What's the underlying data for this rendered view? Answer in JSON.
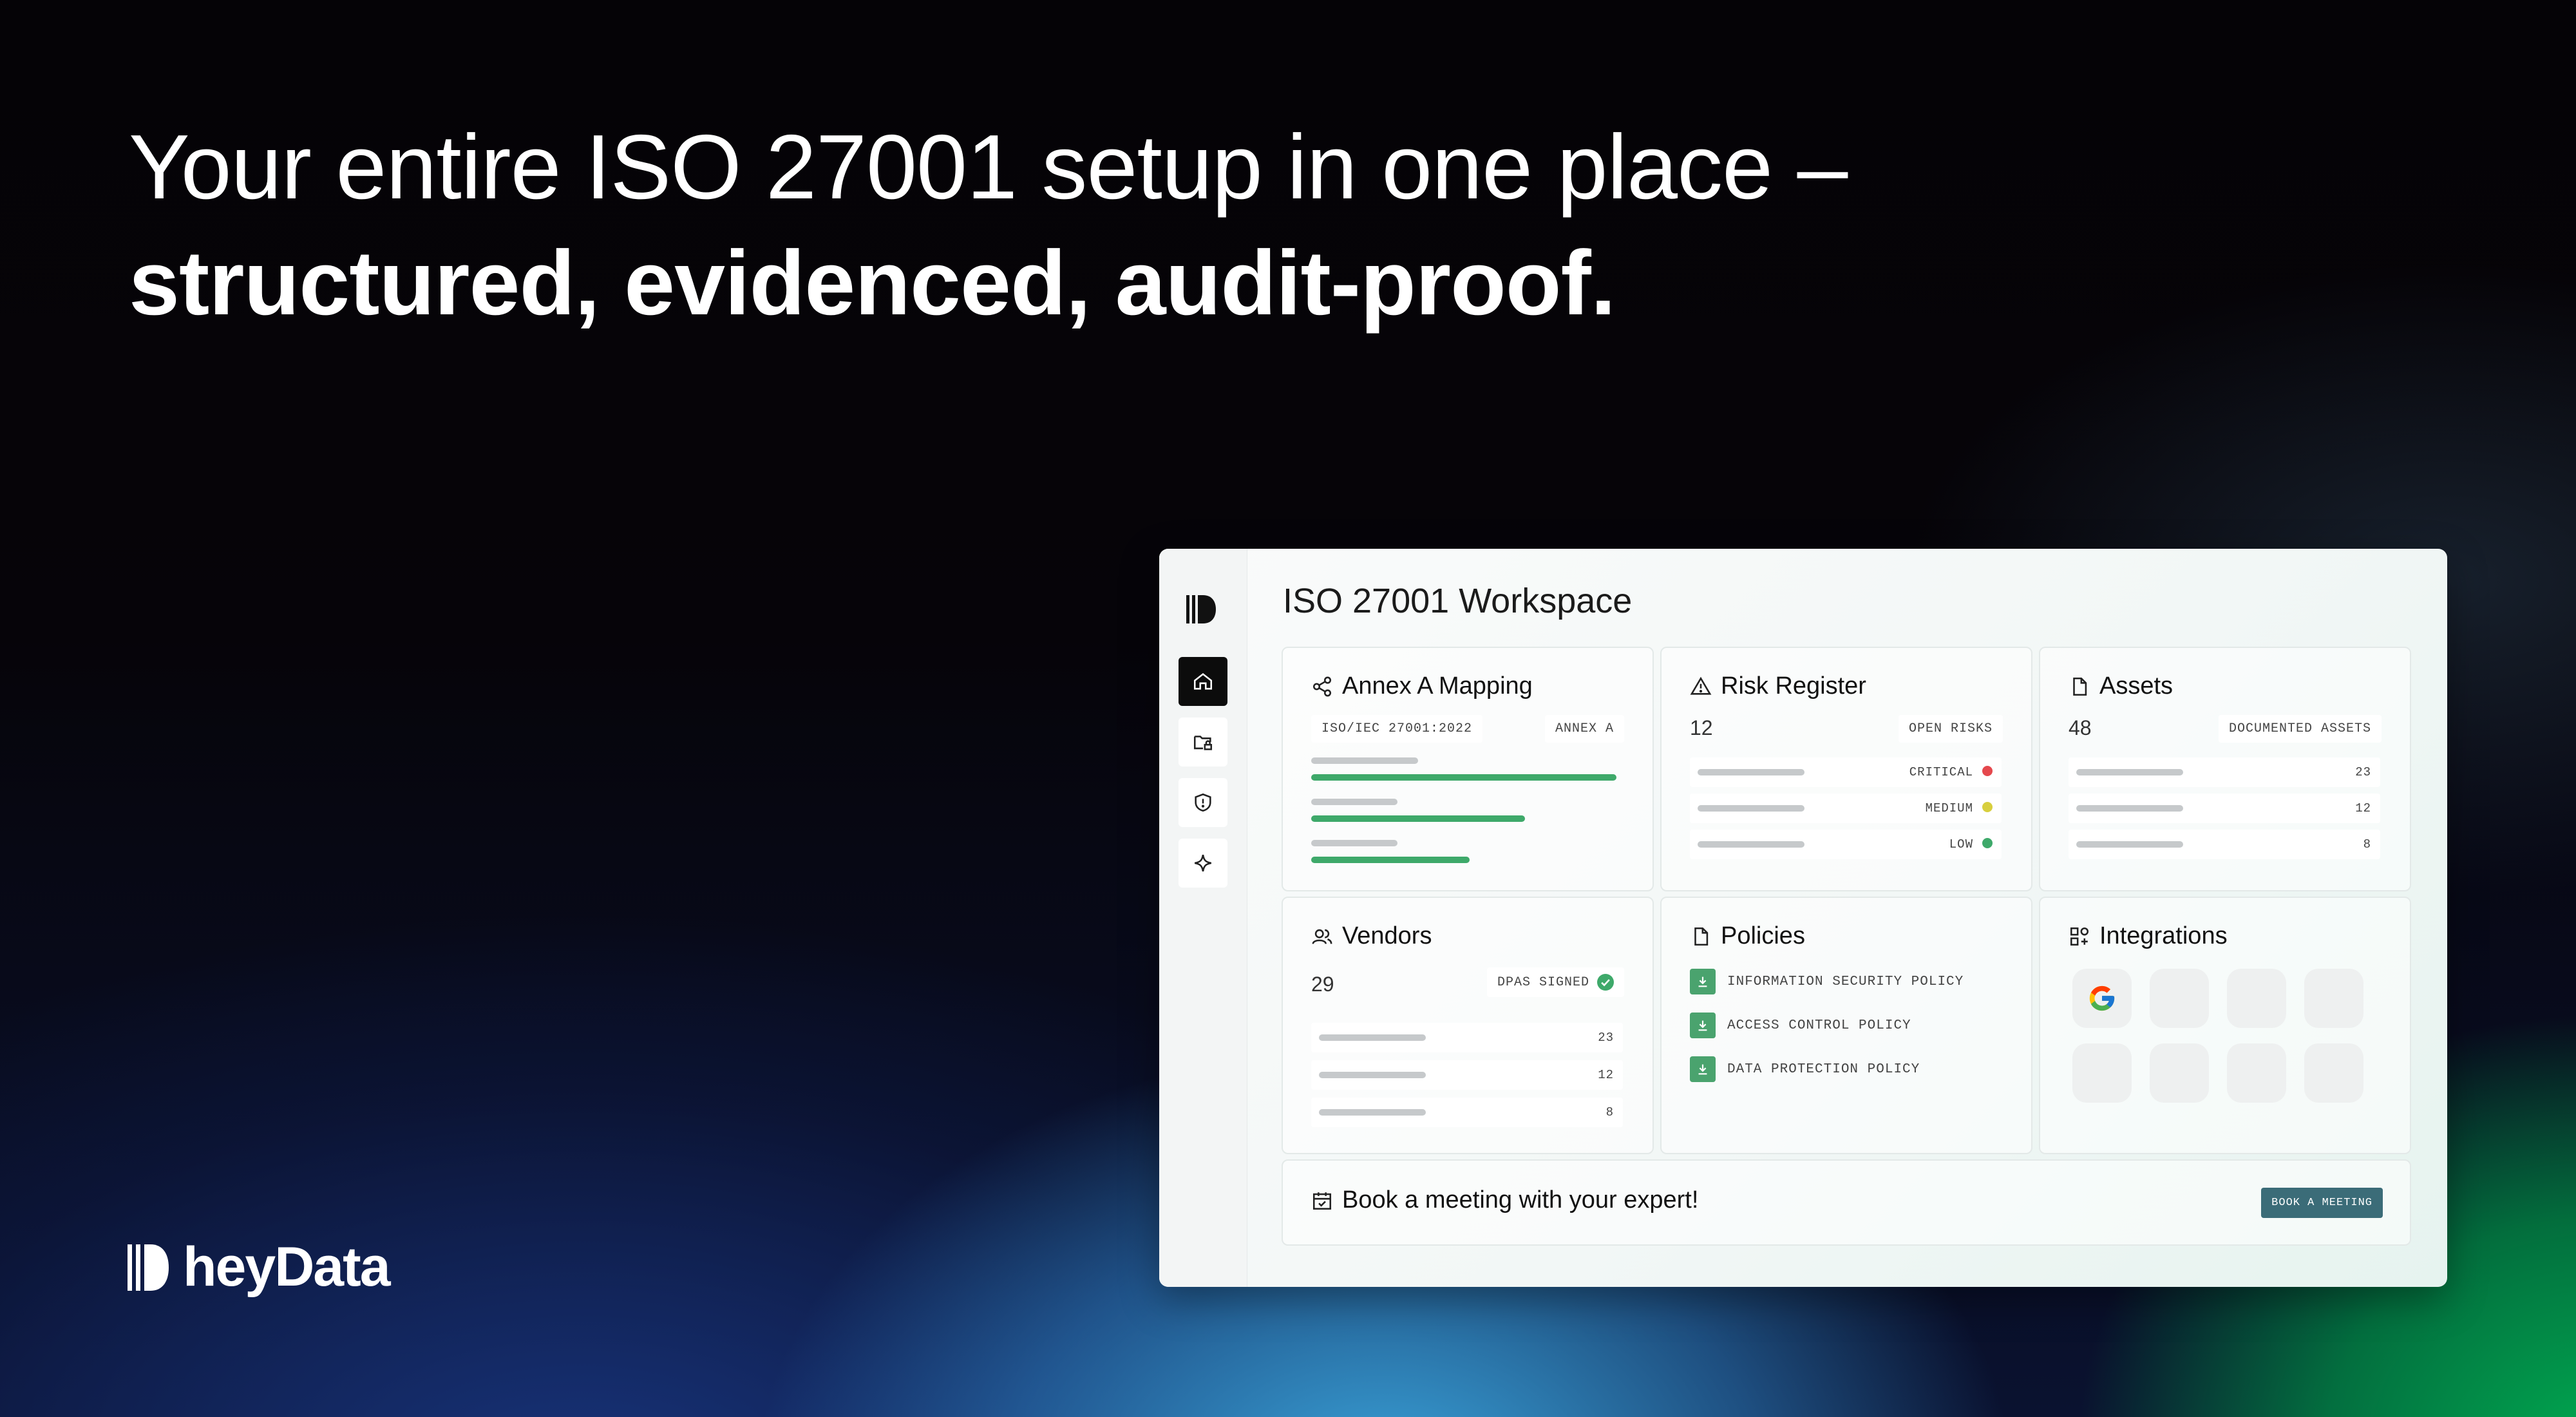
{
  "hero": {
    "line1": "Your entire ISO 27001 setup in one place –",
    "line2": "structured, evidenced, audit-proof."
  },
  "brand": {
    "name": "heyData"
  },
  "sidebar": {
    "items": [
      "home-icon",
      "folder-lock-icon",
      "shield-alert-icon",
      "sparkle-icon"
    ],
    "active": 0
  },
  "workspace": {
    "title": "ISO 27001 Workspace",
    "annex": {
      "title": "Annex A Mapping",
      "tag_left": "ISO/IEC 27001:2022",
      "tag_right": "ANNEX A",
      "progress": [
        1.0,
        0.7,
        0.52
      ]
    },
    "risk": {
      "title": "Risk Register",
      "count": "12",
      "tag": "OPEN RISKS",
      "levels": [
        {
          "label": "CRITICAL",
          "color": "#e5484d"
        },
        {
          "label": "MEDIUM",
          "color": "#d8cf3e"
        },
        {
          "label": "LOW",
          "color": "#3ea96a"
        }
      ]
    },
    "assets": {
      "title": "Assets",
      "count": "48",
      "tag": "DOCUMENTED ASSETS",
      "rows": [
        "23",
        "12",
        "8"
      ]
    },
    "vendors": {
      "title": "Vendors",
      "count": "29",
      "tag": "DPAS SIGNED",
      "rows": [
        "23",
        "12",
        "8"
      ]
    },
    "policies": {
      "title": "Policies",
      "items": [
        "INFORMATION SECURITY POLICY",
        "ACCESS CONTROL POLICY",
        "DATA PROTECTION POLICY"
      ]
    },
    "integrations": {
      "title": "Integrations",
      "first": "google-icon"
    },
    "meeting": {
      "text": "Book a meeting with your expert!",
      "button": "BOOK A MEETING"
    }
  },
  "colors": {
    "accent_green": "#3ea96a",
    "button": "#3b6c78"
  }
}
